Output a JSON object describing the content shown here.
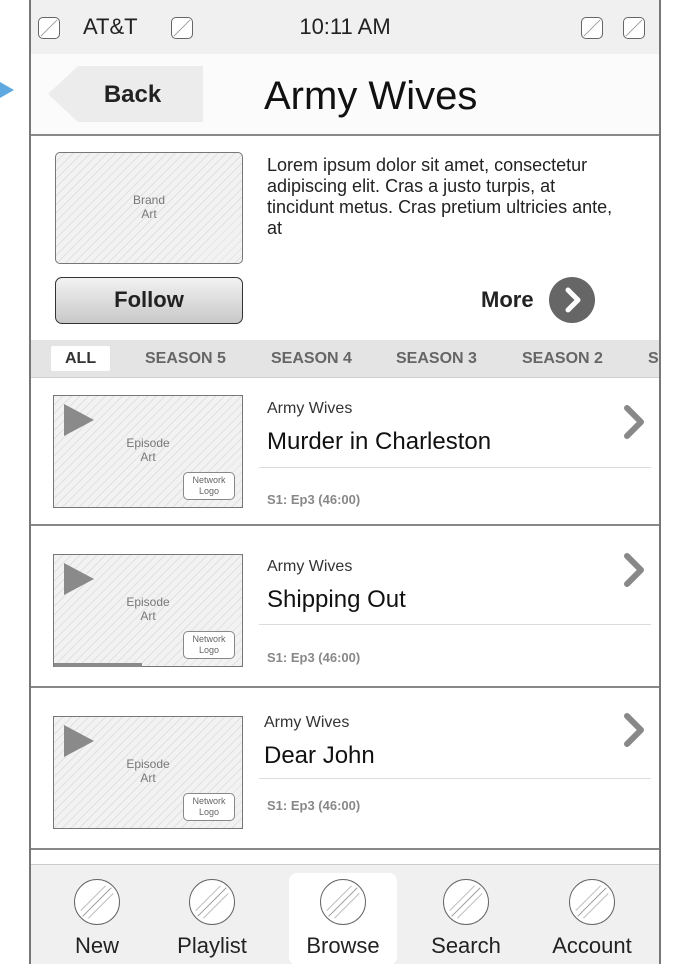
{
  "status_bar": {
    "carrier": "AT&T",
    "time": "10:11 AM"
  },
  "nav": {
    "back_label": "Back",
    "title": "Army Wives"
  },
  "header": {
    "brand_art_label": "Brand\nArt",
    "description": "Lorem ipsum dolor sit amet, consectetur adipiscing elit. Cras a justo turpis, at tincidunt metus. Cras pretium ultricies ante, at",
    "follow_label": "Follow",
    "more_label": "More"
  },
  "season_tabs": [
    "ALL",
    "SEASON 5",
    "SEASON 4",
    "SEASON 3",
    "SEASON 2",
    "SE"
  ],
  "episodes": [
    {
      "show": "Army Wives",
      "title": "Murder in Charleston",
      "meta": "S1: Ep3 (46:00)",
      "art_label": "Episode\nArt",
      "logo_label": "Network\nLogo",
      "progress": 0
    },
    {
      "show": "Army Wives",
      "title": "Shipping Out",
      "meta": "S1: Ep3 (46:00)",
      "art_label": "Episode\nArt",
      "logo_label": "Network\nLogo",
      "progress": 0.47
    },
    {
      "show": "Army Wives",
      "title": "Dear John",
      "meta": "S1: Ep3 (46:00)",
      "art_label": "Episode\nArt",
      "logo_label": "Network\nLogo",
      "progress": 0
    }
  ],
  "tab_bar": {
    "items": [
      {
        "label": "New"
      },
      {
        "label": "Playlist"
      },
      {
        "label": "Browse"
      },
      {
        "label": "Search"
      },
      {
        "label": "Account"
      }
    ],
    "selected": "Browse"
  },
  "colors": {
    "accent_arrow": "#5fa8e0",
    "more_button": "#666666"
  }
}
